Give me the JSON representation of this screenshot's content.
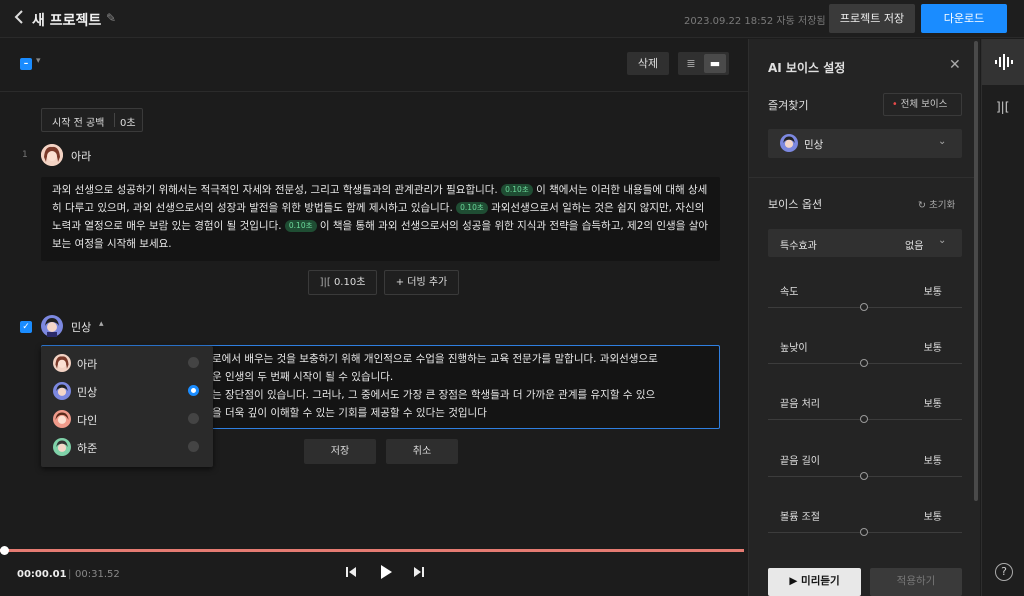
{
  "topbar": {
    "back_icon": "chevron-left-icon",
    "title": "새 프로젝트",
    "autosave": "2023.09.22 18:52 자동 저장됨",
    "save_project": "프로젝트 저장",
    "download": "다운로드",
    "download_color": "#1a8cff"
  },
  "editor": {
    "delete": "삭제",
    "silence": {
      "label": "시작 전 공백",
      "value": "0초"
    },
    "line1": {
      "number": "1",
      "speaker": "아라",
      "p1": "과외 선생으로 성공하기 위해서는 적극적인 자세와 전문성, 그리고 학생들과의 관계관리가 필요합니다.",
      "p2": "이 책에서는 이러한 내용들에 대해 상세히 다루고 있으며, 과외 선생으로서의 성장과 발전을 위한 방법들도 함께 제시하고 있습니다.",
      "p3": "과외선생으로서 일하는 것은 쉽지 않지만, 자신의 노력과 열정으로 매우 보람 있는 경험이 될 것입니다.",
      "p4": "이 책을 통해 과외 선생으로서의 성공을 위한 지식과 전략을 습득하고, 제2의 인생을 살아보는 여정을 시작해 보세요.",
      "pill": "0.10초"
    },
    "pause_chip": "0.10초",
    "add_dubbing": "+ 더빙 추가",
    "line2": {
      "speaker": "민상",
      "r1": "로에서 배우는 것을 보충하기 위해 개인적으로 수업을 진행하는 교육 전문가를 말합니다. 과외선생으로",
      "r2": "운 인생의 두 번째 시작이 될 수 있습니다.",
      "r3": "는 장단점이 있습니다. 그러나, 그 중에서도 가장 큰 장점은 학생들과 더 가까운 관계를 유지할 수 있으",
      "r4": "을 더욱 깊이 이해할 수 있는 기회를 제공할 수 있다는 것입니다"
    },
    "save": "저장",
    "cancel": "취소",
    "speakers": [
      {
        "name": "아라",
        "selected": false
      },
      {
        "name": "민상",
        "selected": true
      },
      {
        "name": "다인",
        "selected": false
      },
      {
        "name": "하준",
        "selected": false
      }
    ]
  },
  "player": {
    "current": "00:00.01",
    "total": "00:31.52",
    "progress_color": "#e57b72"
  },
  "panel": {
    "title": "AI 보이스 설정",
    "favorites": "즐겨찾기",
    "all_voices": "전체 보이스",
    "voice_selected": "민상",
    "voice_options": "보이스 옵션",
    "reset": "초기화",
    "effect_label": "특수효과",
    "effect_value": "없음",
    "options": [
      {
        "label": "속도",
        "value": "보통"
      },
      {
        "label": "높낮이",
        "value": "보통"
      },
      {
        "label": "끝음 처리",
        "value": "보통"
      },
      {
        "label": "끝음 길이",
        "value": "보통"
      },
      {
        "label": "볼륨 조절",
        "value": "보통"
      }
    ],
    "preview": "미리듣기",
    "apply": "적용하기"
  },
  "rail": {
    "help": "?"
  }
}
